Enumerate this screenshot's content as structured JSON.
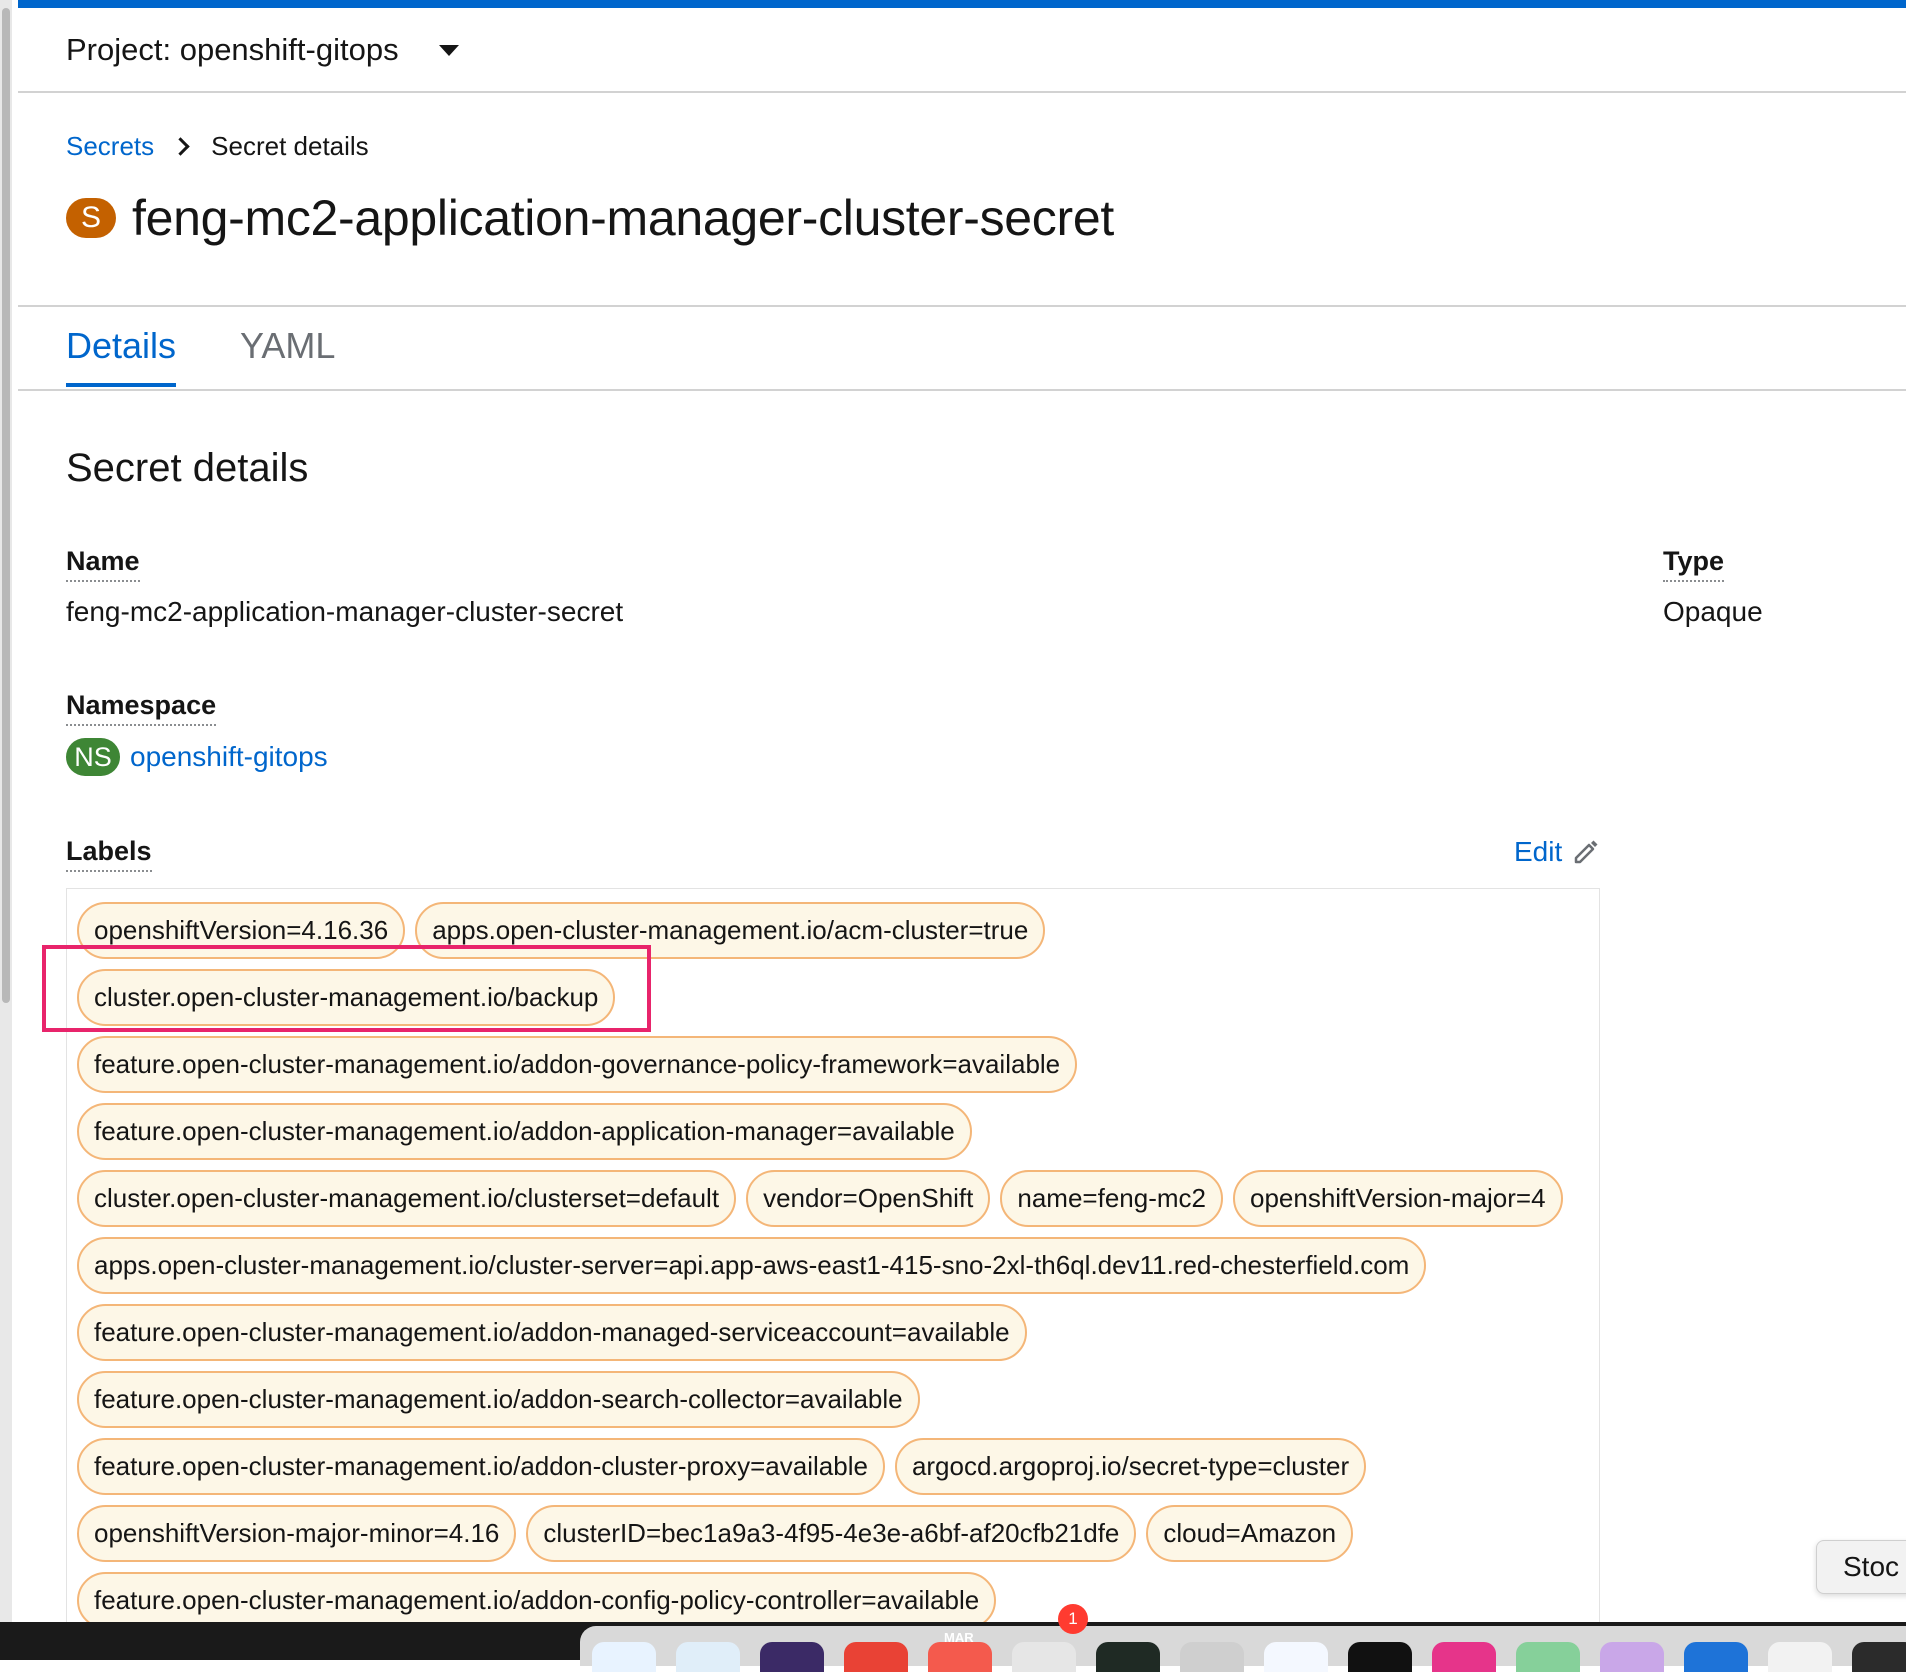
{
  "project": {
    "label": "Project: openshift-gitops"
  },
  "breadcrumb": {
    "parent": "Secrets",
    "current": "Secret details"
  },
  "resource": {
    "badge": "S",
    "title": "feng-mc2-application-manager-cluster-secret"
  },
  "tabs": [
    {
      "label": "Details",
      "active": true
    },
    {
      "label": "YAML",
      "active": false
    }
  ],
  "details": {
    "heading": "Secret details",
    "name_label": "Name",
    "name_value": "feng-mc2-application-manager-cluster-secret",
    "type_label": "Type",
    "type_value": "Opaque",
    "namespace_label": "Namespace",
    "namespace_badge": "NS",
    "namespace_value": "openshift-gitops",
    "labels_label": "Labels",
    "edit_label": "Edit"
  },
  "labels": [
    "openshiftVersion=4.16.36",
    "apps.open-cluster-management.io/acm-cluster=true",
    "cluster.open-cluster-management.io/backup",
    "feature.open-cluster-management.io/addon-governance-policy-framework=available",
    "feature.open-cluster-management.io/addon-application-manager=available",
    "cluster.open-cluster-management.io/clusterset=default",
    "vendor=OpenShift",
    "name=feng-mc2",
    "openshiftVersion-major=4",
    "apps.open-cluster-management.io/cluster-server=api.app-aws-east1-415-sno-2xl-th6ql.dev11.red-chesterfield.com",
    "feature.open-cluster-management.io/addon-managed-serviceaccount=available",
    "feature.open-cluster-management.io/addon-search-collector=available",
    "feature.open-cluster-management.io/addon-cluster-proxy=available",
    "argocd.argoproj.io/secret-type=cluster",
    "openshiftVersion-major-minor=4.16",
    "clusterID=bec1a9a3-4f95-4e3e-a6bf-af20cfb21dfe",
    "cloud=Amazon",
    "feature.open-cluster-management.io/addon-config-policy-controller=available"
  ],
  "highlighted_label_index": 2,
  "tooltip": {
    "text": "Stoc"
  },
  "dock": {
    "calendar_month": "MAR",
    "notification_count": "1"
  },
  "colors": {
    "accent": "#0066cc",
    "secret_badge": "#c46100",
    "namespace_badge": "#3e8635",
    "label_chip_border": "#f4b678",
    "label_chip_bg": "#fdf7e7",
    "highlight": "#e8246b"
  },
  "icons": {
    "project_dropdown": "caret-down-icon",
    "breadcrumb_separator": "chevron-right-icon",
    "edit": "pencil-icon"
  }
}
